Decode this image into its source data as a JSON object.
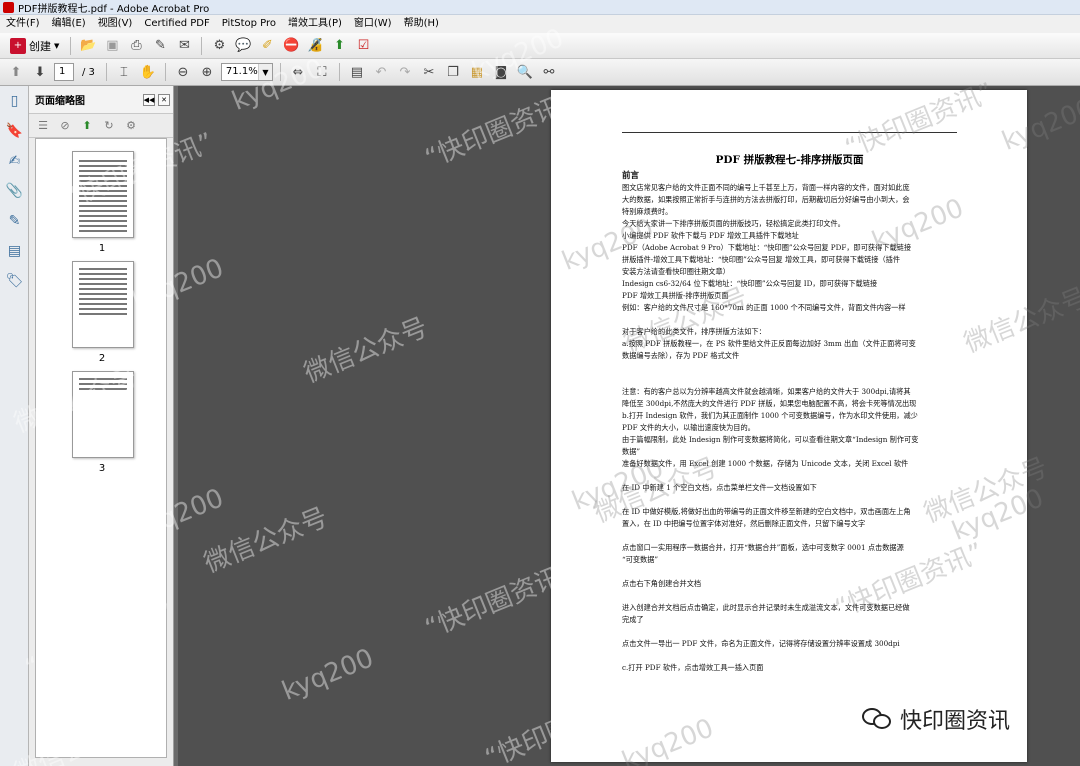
{
  "window": {
    "title": "PDF拼版教程七.pdf - Adobe Acrobat Pro"
  },
  "menu": [
    "文件(F)",
    "编辑(E)",
    "视图(V)",
    "Certified PDF",
    "PitStop Pro",
    "增效工具(P)",
    "窗口(W)",
    "帮助(H)"
  ],
  "toolbar": {
    "create_label": "创建"
  },
  "nav": {
    "current_page": "1",
    "total_pages": "/ 3",
    "zoom": "71.1%"
  },
  "thumbnails": {
    "panel_title": "页面缩略图",
    "labels": [
      "1",
      "2",
      "3"
    ]
  },
  "document": {
    "title": "PDF 拼版教程七-排序拼版页面",
    "lines": [
      {
        "t": "前言",
        "s": "bold"
      },
      {
        "t": "图文店常见客户给的文件正面不同的编号上千甚至上万，背面一样内容的文件，面对如此庞"
      },
      {
        "t": "大的数据，如果按照正常折手与连拼的方法去拼版打印，后期裁切后分好编号由小到大，会"
      },
      {
        "t": "特别麻烦费时。"
      },
      {
        "t": "今天给大家讲一下排序拼版页面的拼版技巧，轻松搞定此类打印文件。"
      },
      {
        "t": "小编提供 PDF 软件下载与 PDF 增效工具插件下载地址"
      },
      {
        "t": "PDF（Adobe Acrobat 9 Pro）下载地址：“快印圈”公众号回复 PDF，即可获得下载链接"
      },
      {
        "t": "拼版插件-增效工具下载地址：“快印圈”公众号回复 增效工具，即可获得下载链接（插件"
      },
      {
        "t": "安装方法请查看快印圈往期文章）"
      },
      {
        "t": "Indesign cs6-32/64 位下载地址：“快印圈”公众号回复 ID，即可获得下载链接"
      },
      {
        "t": "PDF 增效工具拼版-排序拼版页面"
      },
      {
        "t": "例如：客户给的文件尺寸是 160*70m 的正面 1000 个不同编号文件，背面文件内容一样"
      },
      {
        "t": "",
        "s": "gap"
      },
      {
        "t": "对于客户给的此类文件，排序拼版方法如下："
      },
      {
        "t": "a.按照 PDF 拼版教程一，在 PS 软件里给文件正反面每边加好 3mm 出血（文件正面将可变"
      },
      {
        "t": "数据编号去除），存为 PDF 格式文件"
      },
      {
        "t": "",
        "s": "gap2"
      },
      {
        "t": "注意：有的客户总以为分辨率越高文件就会越清晰，如果客户给的文件大于 300dpi,请将其"
      },
      {
        "t": "降低至 300dpi,不然庞大的文件进行 PDF 拼版，如果您电脑配置不高，将会卡死等情况出现"
      },
      {
        "t": "b.打开 Indesign 软件，我们为其正面制作 1000 个可变数据编号，作为水印文件使用，减少"
      },
      {
        "t": "PDF 文件的大小，以输出速度快为目的。"
      },
      {
        "t": "由于篇幅限制，此处 Indesign 制作可变数据将简化，可以查看往期文章“Indesign 制作可变"
      },
      {
        "t": "数据”"
      },
      {
        "t": "准备好数据文件，用 Excel 创建 1000 个数据，存储为 Unicode 文本，关闭 Excel 软件"
      },
      {
        "t": "",
        "s": "gap"
      },
      {
        "t": "在 ID 中新建 1 个空白文档，点击菜单栏文件一文档设置如下"
      },
      {
        "t": "",
        "s": "gap"
      },
      {
        "t": "在 ID 中做好模版,将做好出血的带编号的正面文件移至新建的空白文档中，双击画面左上角"
      },
      {
        "t": "置入，在 ID 中把编号位置字体对准好，然后删除正面文件，只留下编号文字"
      },
      {
        "t": "",
        "s": "gap"
      },
      {
        "t": "点击窗口一实用程序一数据合并，打开“数据合并”面板，选中可变数字 0001 点击数据源"
      },
      {
        "t": "“可变数据”"
      },
      {
        "t": "",
        "s": "gap"
      },
      {
        "t": "点击右下角创建合并文档"
      },
      {
        "t": "",
        "s": "gap"
      },
      {
        "t": "进入创建合并文档后点击确定，此时显示合并记录时未生成溢流文本，文件可变数据已经做"
      },
      {
        "t": "完成了"
      },
      {
        "t": "",
        "s": "gap"
      },
      {
        "t": "点击文件一导出一 PDF 文件，命名为正面文件，记得将存储设置分辨率设置成 300dpi"
      },
      {
        "t": "",
        "s": "gap"
      },
      {
        "t": "c.打开 PDF 软件，点击增效工具一插入页面"
      }
    ]
  },
  "watermark": {
    "texts": [
      "“快印圈资讯”",
      "微信公众号",
      "kyq200"
    ]
  },
  "brand": {
    "label": "快印圈资讯"
  },
  "icons": [
    "create-icon",
    "open-icon",
    "save-icon",
    "print-icon",
    "edit-icon",
    "email-icon",
    "gear-icon",
    "comment-icon",
    "highlight-icon",
    "secure-icon",
    "sign-icon",
    "combine-icon",
    "form-icon",
    "prev-page-icon",
    "next-page-icon",
    "select-icon",
    "hand-icon",
    "zoom-out-icon",
    "zoom-in-icon",
    "fit-width-icon",
    "fit-page-icon",
    "search-icon",
    "binoculars-icon"
  ]
}
